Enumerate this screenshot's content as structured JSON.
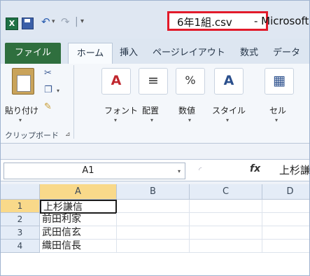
{
  "titlebar": {
    "app_icon": "excel-icon",
    "save_icon": "save-icon",
    "undo_icon": "undo-icon",
    "redo_icon": "redo-icon",
    "customize_icon": "dropdown-caret-icon",
    "document_title": "6年1組.csv",
    "app_title": "- Microsoft",
    "highlight_color": "#e21a2a"
  },
  "tabs": [
    "ファイル",
    "ホーム",
    "挿入",
    "ページレイアウト",
    "数式",
    "データ"
  ],
  "ribbon": {
    "paste_label": "貼り付け",
    "clipboard_group": "クリップボード",
    "font_label": "フォント",
    "align_label": "配置",
    "number_label": "数値",
    "style_label": "スタイル",
    "cells_label": "セル"
  },
  "formula_bar": {
    "name_box": "A1",
    "fx": "fx",
    "value": "上杉謙"
  },
  "sheet": {
    "columns": [
      "A",
      "B",
      "C",
      "D"
    ],
    "rows": [
      {
        "num": "1",
        "a": "上杉謙信"
      },
      {
        "num": "2",
        "a": "前田利家"
      },
      {
        "num": "3",
        "a": "武田信玄"
      },
      {
        "num": "4",
        "a": "織田信長"
      }
    ]
  }
}
